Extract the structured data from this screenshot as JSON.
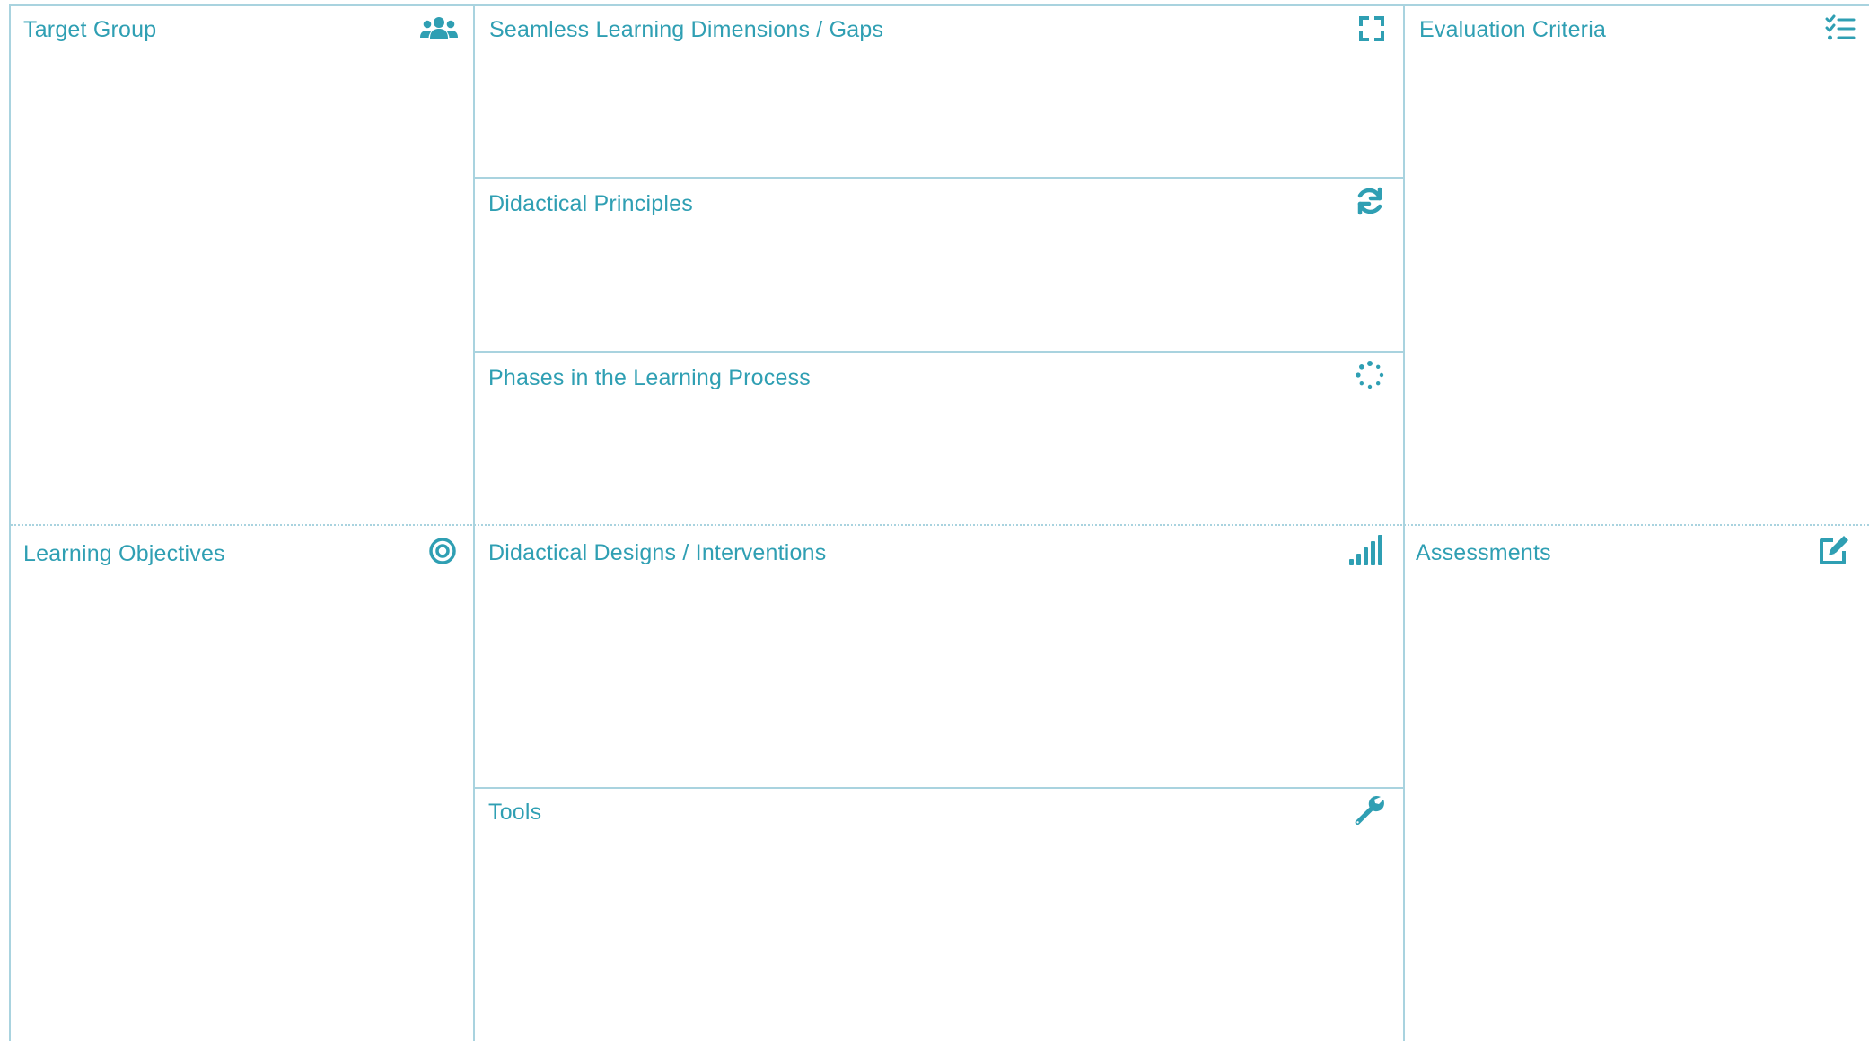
{
  "canvas": {
    "accent_color": "#2f9fb3",
    "grid_line_color": "#a9d3df"
  },
  "sections": {
    "target_group": {
      "title": "Target Group",
      "icon": "users-icon"
    },
    "seamless_dimensions": {
      "title": "Seamless Learning Dimensions / Gaps",
      "icon": "expand-icon"
    },
    "evaluation_criteria": {
      "title": "Evaluation Criteria",
      "icon": "checklist-icon"
    },
    "didactical_principles": {
      "title": "Didactical Principles",
      "icon": "refresh-icon"
    },
    "learning_phases": {
      "title": "Phases in the Learning Process",
      "icon": "spinner-dots-icon"
    },
    "learning_objectives": {
      "title": "Learning Objectives",
      "icon": "target-icon"
    },
    "didactical_designs": {
      "title": "Didactical Designs / Interventions",
      "icon": "signal-bars-icon"
    },
    "assessments": {
      "title": "Assessments",
      "icon": "edit-icon"
    },
    "tools": {
      "title": "Tools",
      "icon": "wrench-icon"
    }
  }
}
